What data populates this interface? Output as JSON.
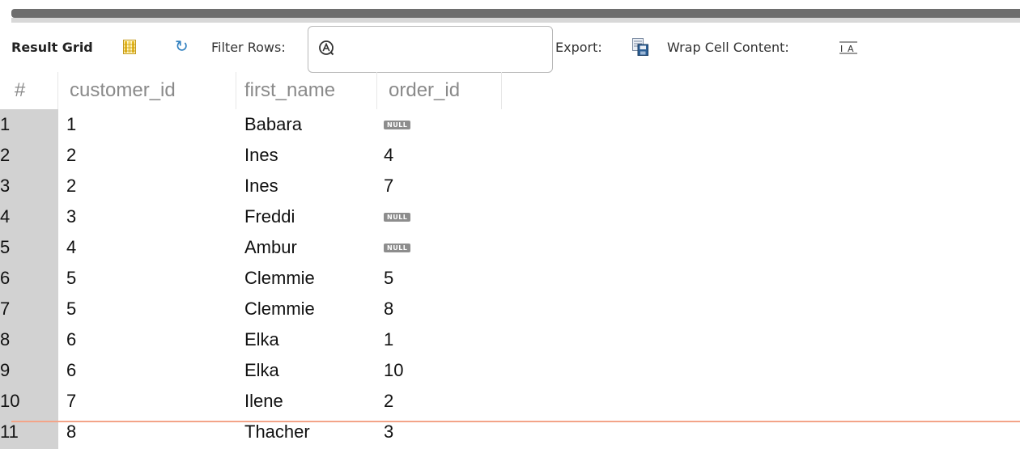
{
  "toolbar": {
    "result_grid_label": "Result Grid",
    "filter_rows_label": "Filter Rows:",
    "filter_value": "",
    "export_label": "Export:",
    "wrap_label": "Wrap Cell Content:"
  },
  "grid": {
    "columns": [
      "#",
      "customer_id",
      "first_name",
      "order_id"
    ],
    "null_text": "NULL",
    "rows": [
      {
        "n": "1",
        "customer_id": "1",
        "first_name": "Babara",
        "order_id": null
      },
      {
        "n": "2",
        "customer_id": "2",
        "first_name": "Ines",
        "order_id": "4"
      },
      {
        "n": "3",
        "customer_id": "2",
        "first_name": "Ines",
        "order_id": "7"
      },
      {
        "n": "4",
        "customer_id": "3",
        "first_name": "Freddi",
        "order_id": null
      },
      {
        "n": "5",
        "customer_id": "4",
        "first_name": "Ambur",
        "order_id": null
      },
      {
        "n": "6",
        "customer_id": "5",
        "first_name": "Clemmie",
        "order_id": "5"
      },
      {
        "n": "7",
        "customer_id": "5",
        "first_name": "Clemmie",
        "order_id": "8"
      },
      {
        "n": "8",
        "customer_id": "6",
        "first_name": "Elka",
        "order_id": "1"
      },
      {
        "n": "9",
        "customer_id": "6",
        "first_name": "Elka",
        "order_id": "10"
      },
      {
        "n": "10",
        "customer_id": "7",
        "first_name": "Ilene",
        "order_id": "2"
      },
      {
        "n": "11",
        "customer_id": "8",
        "first_name": "Thacher",
        "order_id": "3"
      }
    ]
  },
  "colors": {
    "header_text": "#8a8a8a",
    "row_number_bg": "#d2d2d2",
    "null_badge": "#8d8d8d",
    "edit_line": "#f3a488"
  }
}
